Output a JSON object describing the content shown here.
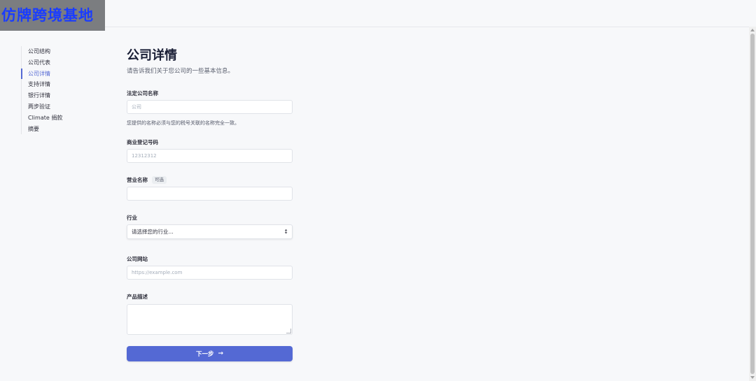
{
  "watermark": "仿牌跨境基地",
  "sidebar": {
    "items": [
      {
        "label": "公司结构"
      },
      {
        "label": "公司代表"
      },
      {
        "label": "公司详情",
        "active": true
      },
      {
        "label": "支持详情"
      },
      {
        "label": "银行详情"
      },
      {
        "label": "两步验证"
      },
      {
        "label": "Climate 捐款"
      },
      {
        "label": "摘要"
      }
    ]
  },
  "main": {
    "title": "公司详情",
    "subtitle": "请告诉我们关于您公司的一些基本信息。",
    "fields": {
      "legal_name": {
        "label": "法定公司名称",
        "placeholder": "公司",
        "hint": "您提供的名称必须与您的税号关联的名称完全一致。"
      },
      "registration_number": {
        "label": "商业登记号码",
        "placeholder": "12312312"
      },
      "business_name": {
        "label": "营业名称",
        "badge": "可选",
        "value": ""
      },
      "industry": {
        "label": "行业",
        "selected": "请选择您的行业..."
      },
      "website": {
        "label": "公司网站",
        "placeholder": "https://example.com"
      },
      "description": {
        "label": "产品描述",
        "value": ""
      }
    },
    "next_button": {
      "label": "下一步",
      "arrow": "→"
    }
  },
  "colors": {
    "accent": "#5469d4",
    "background": "#f7f8fa",
    "watermark_text": "#1a3cff"
  }
}
